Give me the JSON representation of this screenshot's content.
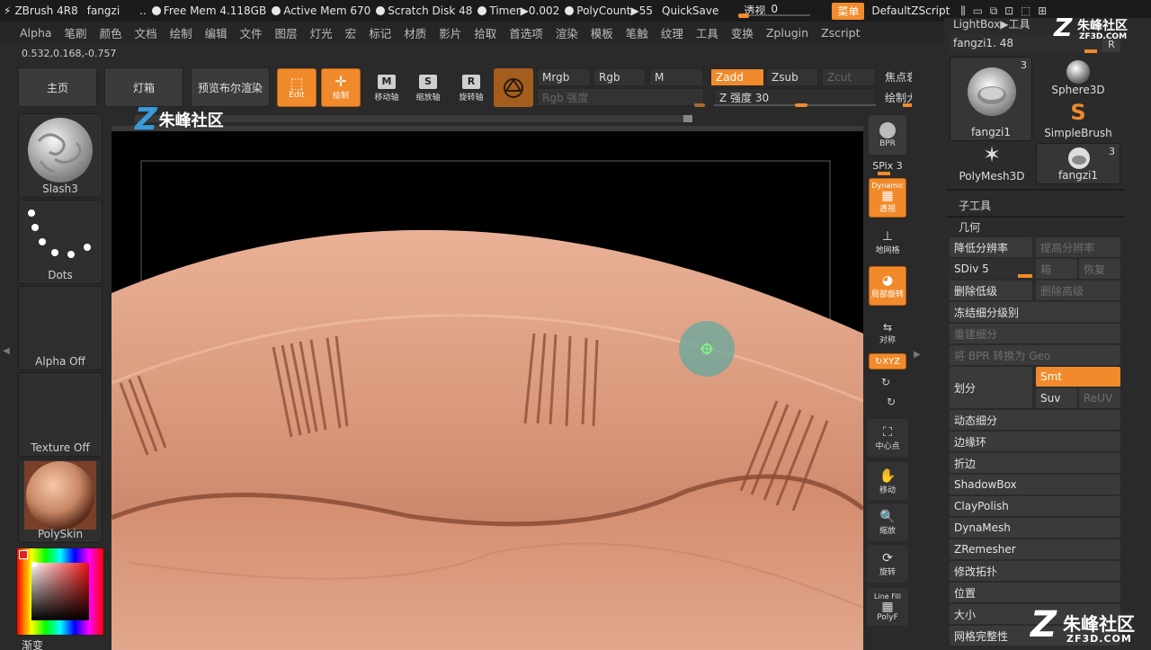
{
  "titlebar": {
    "app": "ZBrush 4R8",
    "doc": "fangzi",
    "sep": "..",
    "free_mem": "Free Mem 4.118GB",
    "active_mem": "Active Mem 670",
    "scratch_disk": "Scratch Disk 48",
    "timer": "Timer▶0.002",
    "polycount": "PolyCount▶55",
    "quicksave": "QuickSave",
    "transparency_label": "透视",
    "transparency_value": "0",
    "menu_label": "菜单",
    "script_label": "DefaultZScript"
  },
  "menubar": [
    "Alpha",
    "笔刷",
    "颜色",
    "文档",
    "绘制",
    "编辑",
    "文件",
    "图层",
    "灯光",
    "宏",
    "标记",
    "材质",
    "影片",
    "拾取",
    "首选项",
    "渲染",
    "模板",
    "笔触",
    "纹理",
    "工具",
    "变换",
    "Zplugin",
    "Zscript"
  ],
  "coords": "0.532,0.168,-0.757",
  "toolbar": {
    "home": "主页",
    "lightbox": "灯箱",
    "bpr_preview": "预览布尔渲染",
    "edit": "Edit",
    "draw": "绘制",
    "move": "移动轴",
    "scale": "缩放轴",
    "rotate": "旋转轴",
    "move_key": "M",
    "scale_key": "S",
    "rotate_key": "R",
    "mrgb": "Mrgb",
    "rgb": "Rgb",
    "m": "M",
    "zadd": "Zadd",
    "zsub": "Zsub",
    "zcut": "Zcut",
    "rgb_intensity": "Rgb 强度",
    "z_intensity": "Z 强度 30",
    "focal": "焦点衰",
    "draw_size": "绘制大"
  },
  "left_shelf": {
    "brush": "Slash3",
    "stroke": "Dots",
    "alpha": "Alpha Off",
    "texture": "Texture Off",
    "material": "PolySkin",
    "gradient": "渐变"
  },
  "canvas": {
    "watermark": "朱峰社区"
  },
  "right_tools": {
    "bpr": "BPR",
    "spix": "SPix 3",
    "dynamic": "Dynamic",
    "persp": "透视",
    "floor": "地网格",
    "local": "局部旋转",
    "sym": "对称",
    "xyz": "XYZ",
    "frame": "中心点",
    "move": "移动",
    "scale": "缩放",
    "rotate": "旋转",
    "linefill": "Line Fill",
    "polyf": "PolyF"
  },
  "right_panel": {
    "lightbox_tools": "LightBox▶工具",
    "tool_name": "fangzi1. 48",
    "r_key": "R",
    "thumbs": [
      {
        "label": "fangzi1",
        "count": "3"
      },
      {
        "label": "Sphere3D",
        "count": ""
      },
      {
        "label": "SimpleBrush",
        "count": ""
      },
      {
        "label": "PolyMesh3D",
        "count": ""
      },
      {
        "label": "fangzi1",
        "count": "3"
      }
    ],
    "subtool": "子工具",
    "geometry": "几何",
    "lower_res": "降低分辨率",
    "higher_res": "提高分辨率",
    "sdiv": "SDiv 5",
    "cage": "箱",
    "restore": "恢复",
    "del_lower": "删除低级",
    "del_higher": "删除高级",
    "freeze_sub": "冻结细分级别",
    "reconstruct": "重建细分",
    "bpr_to_geo": "将 BPR 转换为 Geo",
    "divide": "划分",
    "smt": "Smt",
    "suv": "Suv",
    "reuv": "ReUV",
    "dyn_sub": "动态细分",
    "edge_loop": "边缘环",
    "crease": "折边",
    "shadowbox": "ShadowBox",
    "claypolish": "ClayPolish",
    "dynamesh": "DynaMesh",
    "zremesher": "ZRemesher",
    "modify_topo": "修改拓扑",
    "position": "位置",
    "size": "大小",
    "mesh_integrity": "网格完整性",
    "logo_cn": "朱峰社区",
    "logo_en": "ZF3D.COM"
  }
}
